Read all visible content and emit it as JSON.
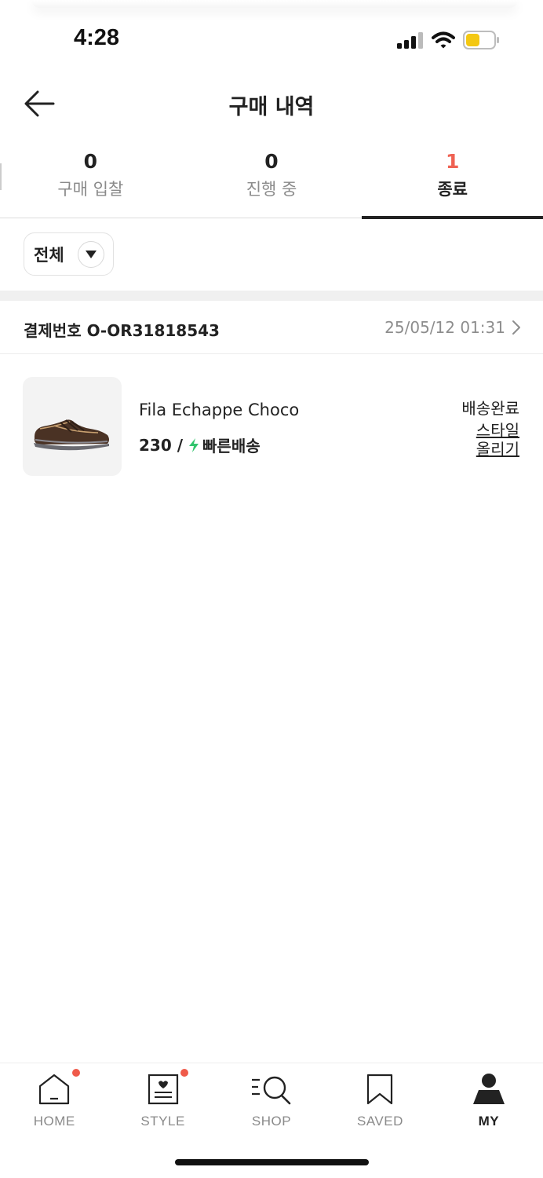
{
  "status_bar": {
    "time": "4:28"
  },
  "header": {
    "title": "구매 내역"
  },
  "tabs": [
    {
      "count": "0",
      "label": "구매 입찰"
    },
    {
      "count": "0",
      "label": "진행 중"
    },
    {
      "count": "1",
      "label": "종료"
    }
  ],
  "filter": {
    "label": "전체"
  },
  "order": {
    "number": "결제번호 O-OR31818543",
    "date": "25/05/12 01:31"
  },
  "item": {
    "name": "Fila Echappe Choco",
    "size": "230 /",
    "delivery": "빠른배송",
    "status": "배송완료",
    "style_link": "스타일 올리기"
  },
  "bottom_nav": [
    {
      "label": "HOME"
    },
    {
      "label": "STYLE"
    },
    {
      "label": "SHOP"
    },
    {
      "label": "SAVED"
    },
    {
      "label": "MY"
    }
  ],
  "colors": {
    "accent": "#ef6253",
    "fast_delivery": "#31c46c",
    "badge": "#ef5a4a"
  }
}
